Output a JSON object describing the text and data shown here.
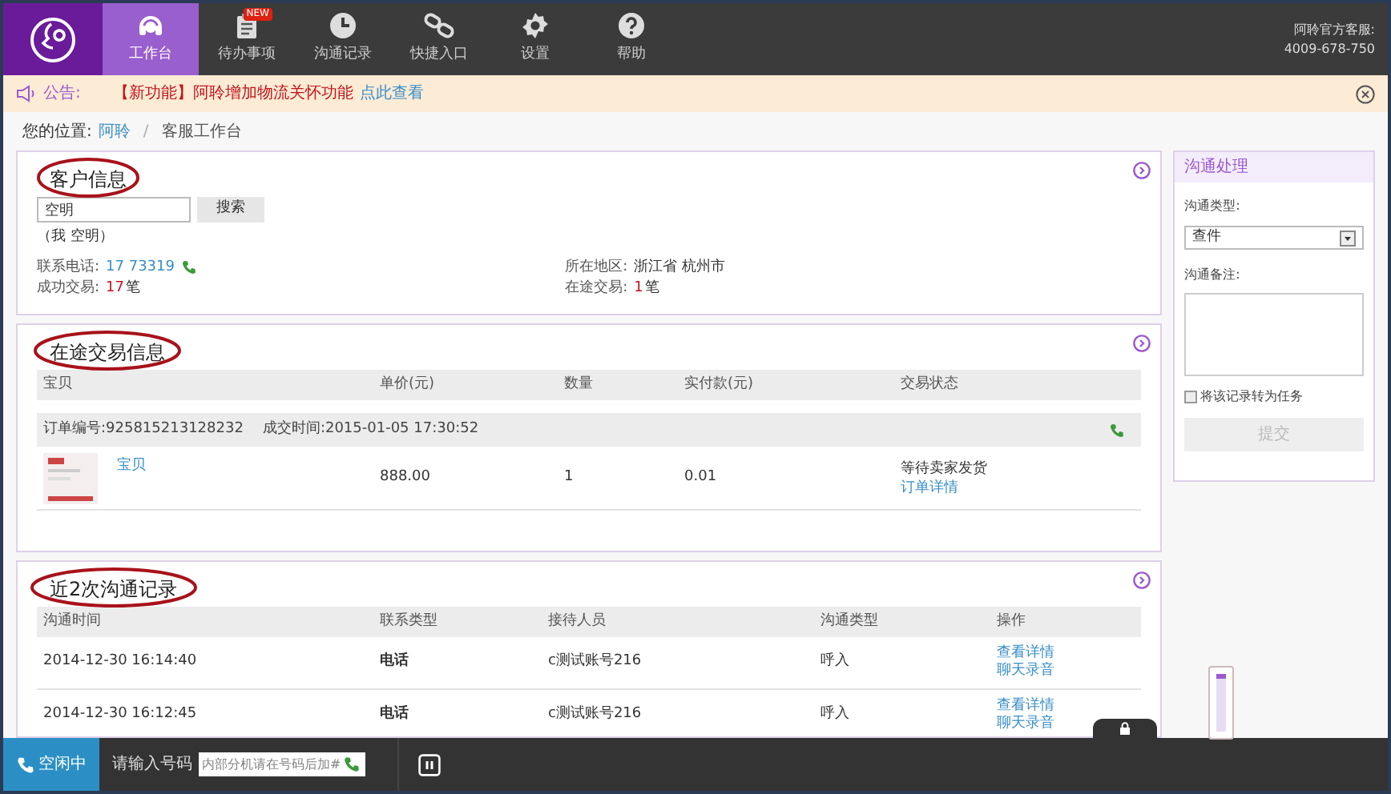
{
  "nav": {
    "tabs": [
      {
        "label": "工作台",
        "selected": true
      },
      {
        "label": "待办事项",
        "badge": "NEW",
        "selected": false
      },
      {
        "label": "沟通记录",
        "selected": false
      },
      {
        "label": "快捷入口",
        "selected": false
      },
      {
        "label": "设置",
        "selected": false
      },
      {
        "label": "帮助",
        "selected": false
      }
    ],
    "service": {
      "label": "阿聆官方客服:",
      "phone": "4009-678-750"
    }
  },
  "notice": {
    "label": "公告:",
    "tag": "【新功能】阿聆增加物流关怀功能",
    "link": "点此查看"
  },
  "breadcrumb": {
    "label": "您的位置:",
    "separator": "/",
    "items": [
      "阿聆",
      "客服工作台"
    ]
  },
  "customer": {
    "title": "客户信息",
    "search_value": "空明",
    "search_button": "搜索",
    "name": "（我 空明）",
    "left": [
      {
        "label": "联系电话:",
        "value": "17 73319",
        "kind": "phone"
      },
      {
        "label": "成功交易:",
        "value": "17",
        "unit": "笔",
        "kind": "count"
      }
    ],
    "right": [
      {
        "label": "所在地区:",
        "value": "浙江省 杭州市",
        "kind": "plain"
      },
      {
        "label": "在途交易:",
        "value": "1",
        "unit": "笔",
        "kind": "count"
      }
    ]
  },
  "trades": {
    "title": "在途交易信息",
    "columns": [
      "宝贝",
      "单价(元)",
      "数量",
      "实付款(元)",
      "交易状态"
    ],
    "orders": [
      {
        "order_label": "订单编号:",
        "order_no": "925815213128232",
        "time_label": "成交时间:",
        "time": "2015-01-05 17:30:52",
        "product": "宝贝",
        "price": "888.00",
        "qty": "1",
        "paid": "0.01",
        "status": "等待卖家发货",
        "link": "订单详情"
      }
    ]
  },
  "records": {
    "title": "近2次沟通记录",
    "columns": [
      "沟通时间",
      "联系类型",
      "接待人员",
      "沟通类型",
      "操作"
    ],
    "rows": [
      {
        "time": "2014-12-30 16:14:40",
        "type": "电话",
        "agent": "c测试账号216",
        "direction": "呼入",
        "links": [
          "查看详情",
          "聊天录音"
        ]
      },
      {
        "time": "2014-12-30 16:12:45",
        "type": "电话",
        "agent": "c测试账号216",
        "direction": "呼入",
        "links": [
          "查看详情",
          "聊天录音"
        ]
      }
    ]
  },
  "side": {
    "title": "沟通处理",
    "type_label": "沟通类型:",
    "type_value": "查件",
    "note_label": "沟通备注:",
    "checkbox": {
      "label": "将该记录转为任务",
      "checked": false
    },
    "submit": {
      "label": "提交",
      "disabled": true
    }
  },
  "bottom": {
    "status": "空闲中",
    "prompt": "请输入号码",
    "placeholder": "内部分机请在号码后加#"
  }
}
